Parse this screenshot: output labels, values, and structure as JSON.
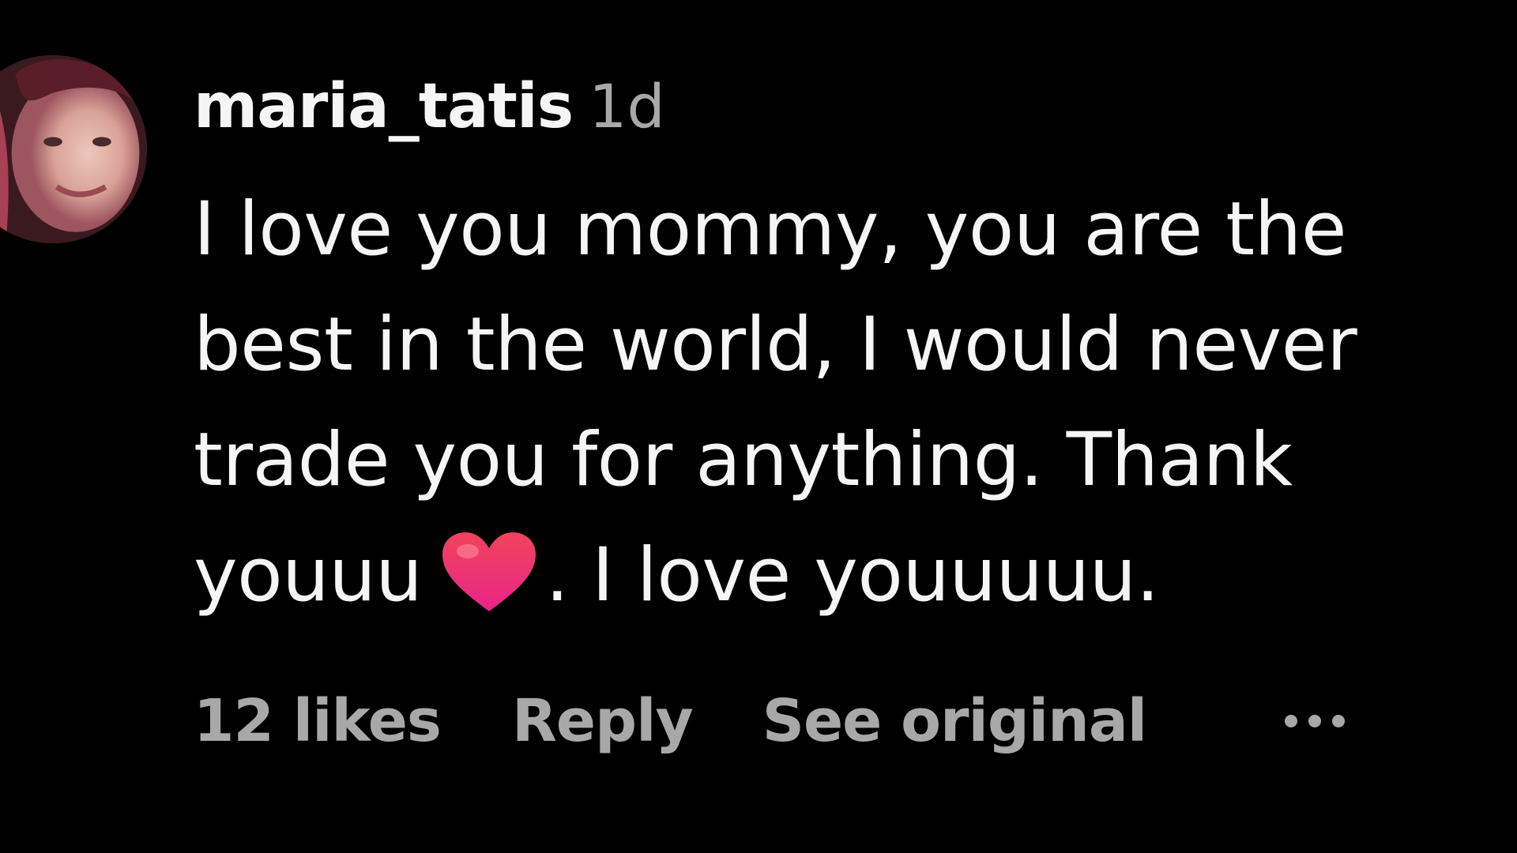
{
  "comment": {
    "username": "maria_tatis",
    "timestamp": "1d",
    "text_part1": "I love you mommy, you are the best in the world, I would never trade you for anything. Thank youuu",
    "text_part2": ". I love youuuuu.",
    "emoji_icon": "red-heart-icon",
    "avatar_icon": "profile-photo"
  },
  "actions": {
    "likes": "12 likes",
    "reply": "Reply",
    "see_original": "See original",
    "more_icon": "more-options-icon"
  },
  "colors": {
    "background": "#000000",
    "primary_text": "#f5f5f5",
    "secondary_text": "#a8a8a8",
    "heart": "#f0305c"
  }
}
